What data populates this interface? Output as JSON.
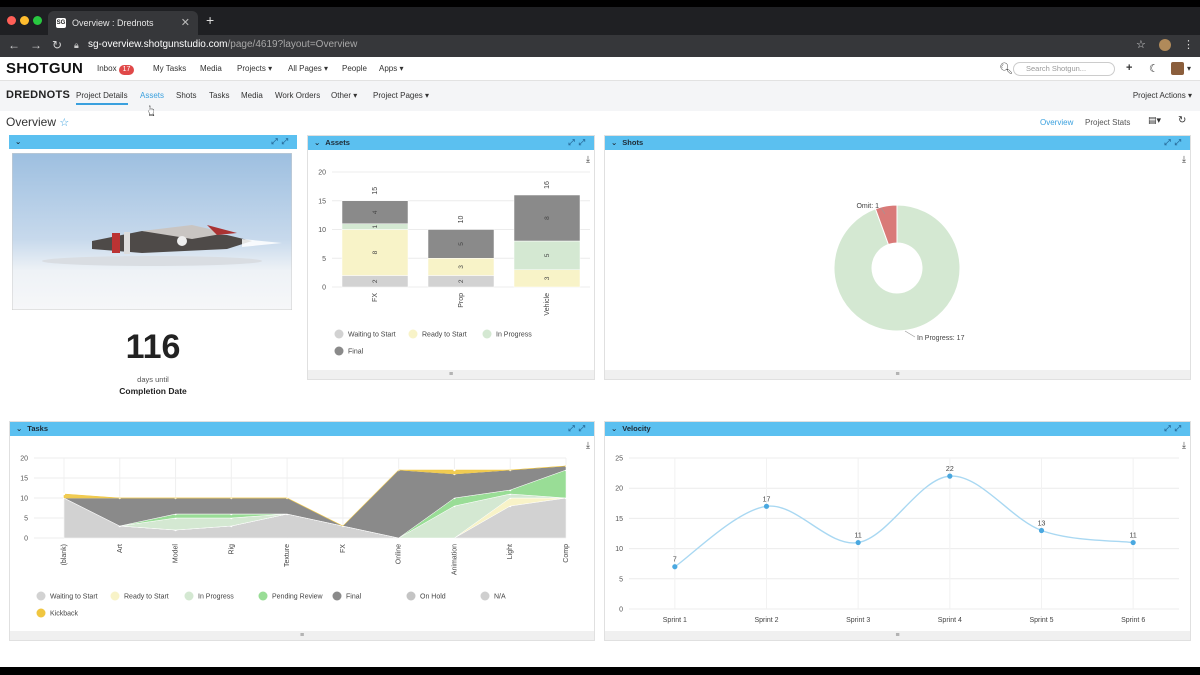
{
  "browser": {
    "tab_title": "Overview : Drednots",
    "tab_favicon": "SG",
    "url_host": "sg-overview.shotgunstudio.com",
    "url_path": "/page/4619?layout=Overview"
  },
  "header": {
    "logo": "SHOTGUN",
    "inbox_label": "Inbox",
    "inbox_count": "17",
    "nav": [
      "My Tasks",
      "Media",
      "Projects ▾",
      "All Pages ▾",
      "People",
      "Apps ▾"
    ],
    "search_placeholder": "Search Shotgun..."
  },
  "project": {
    "name": "DREDNOTS",
    "tabs": [
      "Project Details",
      "Assets",
      "Shots",
      "Tasks",
      "Media",
      "Work Orders",
      "Other ▾",
      "Project Pages ▾"
    ],
    "active_tab": "Project Details",
    "actions_label": "Project Actions ▾"
  },
  "overview": {
    "title": "Overview",
    "links": [
      "Overview",
      "Project Stats"
    ]
  },
  "hero": {
    "days_value": "116",
    "days_label": "days until",
    "completion_label": "Completion Date"
  },
  "widgets": {
    "assets_title": "Assets",
    "shots_title": "Shots",
    "tasks_title": "Tasks",
    "velocity_title": "Velocity"
  },
  "colors": {
    "accent": "#5bc0f0",
    "link": "#3aa0de",
    "waiting": "#d2d2d2",
    "ready": "#f8f3c8",
    "in_progress": "#d4e8d2",
    "pending_review": "#99dd96",
    "final": "#8a8a8a",
    "on_hold": "#c4c4c4",
    "na": "#cfcfcf",
    "kickback": "#f0c640",
    "omit": "#d97a78",
    "velocity_line": "#a9d8f2",
    "velocity_point": "#4aa8e0"
  },
  "chart_data": [
    {
      "type": "bar",
      "stacked": true,
      "categories": [
        "FX",
        "Prop",
        "Vehicle"
      ],
      "series": [
        {
          "name": "Waiting to Start",
          "values": [
            2,
            2,
            0
          ]
        },
        {
          "name": "Ready to Start",
          "values": [
            8,
            3,
            3
          ]
        },
        {
          "name": "In Progress",
          "values": [
            1,
            0,
            5
          ]
        },
        {
          "name": "Final",
          "values": [
            4,
            5,
            8
          ]
        }
      ],
      "totals": [
        15,
        10,
        16
      ],
      "ylim": [
        0,
        20
      ],
      "yticks": [
        0,
        5,
        10,
        15,
        20
      ]
    },
    {
      "type": "pie",
      "donut": true,
      "slices": [
        {
          "name": "In Progress",
          "value": 17,
          "label": "In Progress: 17"
        },
        {
          "name": "Omit",
          "value": 1,
          "label": "Omit: 1"
        }
      ]
    },
    {
      "type": "area",
      "stacked": true,
      "categories": [
        "(blank)",
        "Art",
        "Model",
        "Rig",
        "Texture",
        "FX",
        "Online",
        "Animation",
        "Light",
        "Comp"
      ],
      "series": [
        {
          "name": "Waiting to Start",
          "values": [
            10,
            3,
            2,
            3,
            6,
            3,
            0,
            0,
            8,
            10
          ]
        },
        {
          "name": "Ready to Start",
          "values": [
            0,
            0,
            0,
            0,
            0,
            0,
            0,
            0,
            2,
            0
          ]
        },
        {
          "name": "In Progress",
          "values": [
            0,
            0,
            3,
            2,
            0,
            0,
            0,
            8,
            1,
            0
          ]
        },
        {
          "name": "Pending Review",
          "values": [
            0,
            0,
            1,
            1,
            0,
            0,
            0,
            2,
            1,
            7
          ]
        },
        {
          "name": "Final",
          "values": [
            0,
            7,
            4,
            4,
            4,
            0,
            17,
            6,
            5,
            1
          ]
        },
        {
          "name": "On Hold",
          "values": [
            0,
            0,
            0,
            0,
            0,
            0,
            0,
            0,
            0,
            0
          ]
        },
        {
          "name": "N/A",
          "values": [
            0,
            0,
            0,
            0,
            0,
            0,
            0,
            0,
            0,
            0
          ]
        },
        {
          "name": "Kickback",
          "values": [
            1,
            0,
            0,
            0,
            0,
            0,
            0,
            1,
            0,
            0
          ]
        }
      ],
      "ylim": [
        0,
        20
      ],
      "yticks": [
        0,
        5,
        10,
        15,
        20
      ]
    },
    {
      "type": "line",
      "smooth": true,
      "categories": [
        "Sprint 1",
        "Sprint 2",
        "Sprint 3",
        "Sprint 4",
        "Sprint 5",
        "Sprint 6"
      ],
      "values": [
        7,
        17,
        11,
        22,
        13,
        11
      ],
      "ylim": [
        0,
        25
      ],
      "yticks": [
        0,
        5,
        10,
        15,
        20,
        25
      ]
    }
  ]
}
